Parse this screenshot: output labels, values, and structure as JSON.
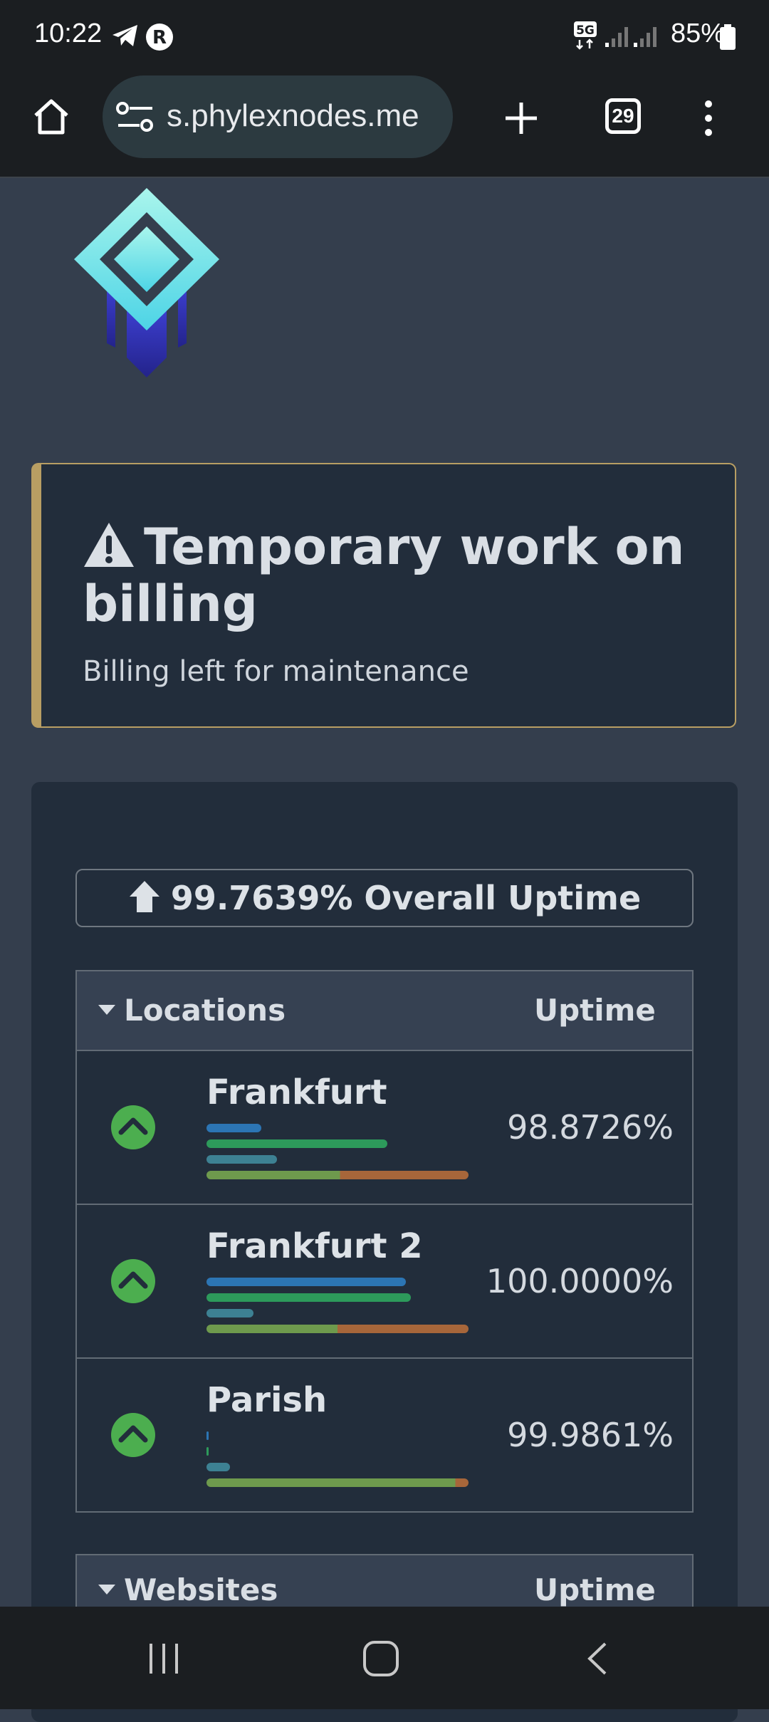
{
  "status_bar": {
    "time": "10:22",
    "battery": "85%",
    "network": "5G"
  },
  "browser": {
    "url": "s.phylexnodes.me",
    "tab_count": "29"
  },
  "alert": {
    "title": "Temporary work on billing",
    "message": "Billing left for maintenance",
    "color": "#b89e63"
  },
  "overall": {
    "text": "99.7639% Overall Uptime"
  },
  "locations": {
    "header_name": "Locations",
    "header_uptime": "Uptime",
    "rows": [
      {
        "name": "Frankfurt",
        "uptime": "98.8726%",
        "status": "up",
        "bars": [
          0.21,
          0.69,
          0.27,
          0.51
        ]
      },
      {
        "name": "Frankfurt 2",
        "uptime": "100.0000%",
        "status": "up",
        "bars": [
          0.76,
          0.78,
          0.18,
          0.5
        ]
      },
      {
        "name": "Parish",
        "uptime": "99.9861%",
        "status": "up",
        "bars": [
          0.005,
          0.005,
          0.09,
          0.95
        ]
      }
    ]
  },
  "websites": {
    "header_name": "Websites",
    "header_uptime": "Uptime"
  },
  "colors": {
    "up_green": "#4cae4f",
    "background": "#343e4d",
    "card": "#222d3b"
  }
}
